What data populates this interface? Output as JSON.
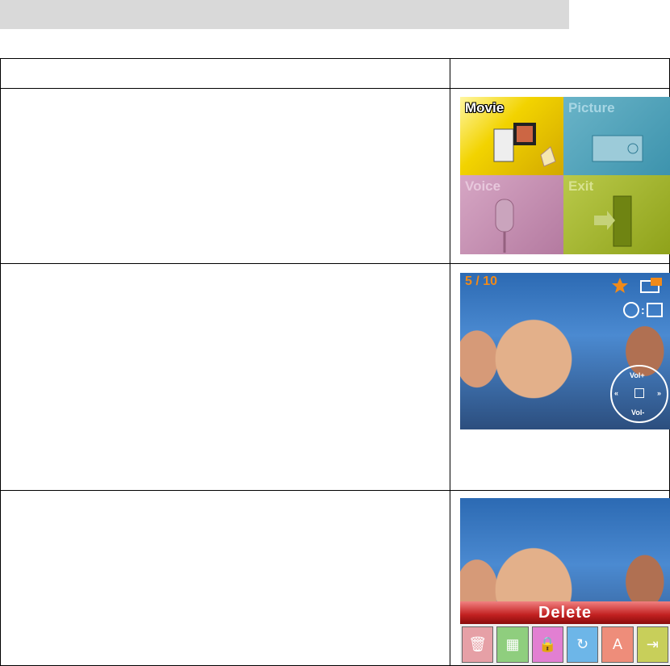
{
  "menu": {
    "tiles": [
      {
        "label": "Movie"
      },
      {
        "label": "Picture"
      },
      {
        "label": "Voice"
      },
      {
        "label": "Exit"
      }
    ]
  },
  "playback": {
    "counter": "5 / 10",
    "vol_up": "Vol+",
    "vol_down": "Vol-"
  },
  "delete_screen": {
    "title": "Delete",
    "icons": [
      "trash-icon",
      "grid-icon",
      "lock-icon",
      "rotate-icon",
      "auto-icon",
      "exit-icon"
    ]
  }
}
